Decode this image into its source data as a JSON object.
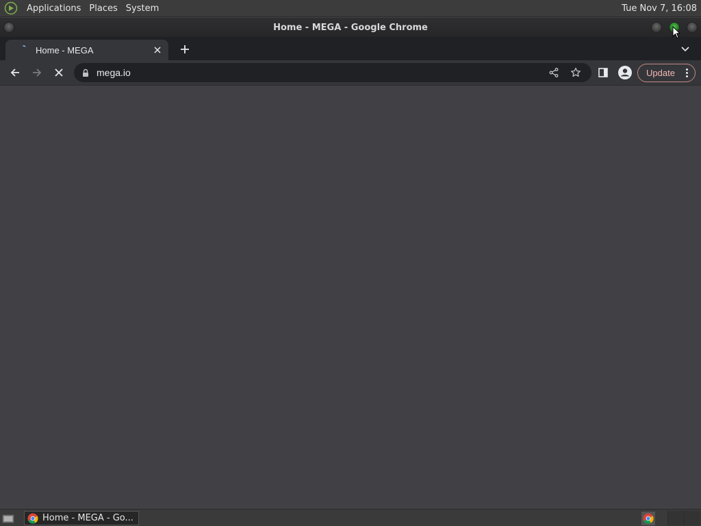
{
  "top_panel": {
    "menus": [
      "Applications",
      "Places",
      "System"
    ],
    "clock": "Tue Nov  7, 16:08"
  },
  "window": {
    "title": "Home - MEGA - Google Chrome"
  },
  "browser": {
    "tab": {
      "title": "Home - MEGA"
    },
    "omnibox": {
      "url": "mega.io"
    },
    "update_label": "Update"
  },
  "taskbar": {
    "task_label": "Home - MEGA - Go..."
  },
  "colors": {
    "content_bg": "#414145",
    "toolbar_bg": "#35363a",
    "tabstrip_bg": "#202124",
    "update_accent": "#f2b8b5"
  }
}
